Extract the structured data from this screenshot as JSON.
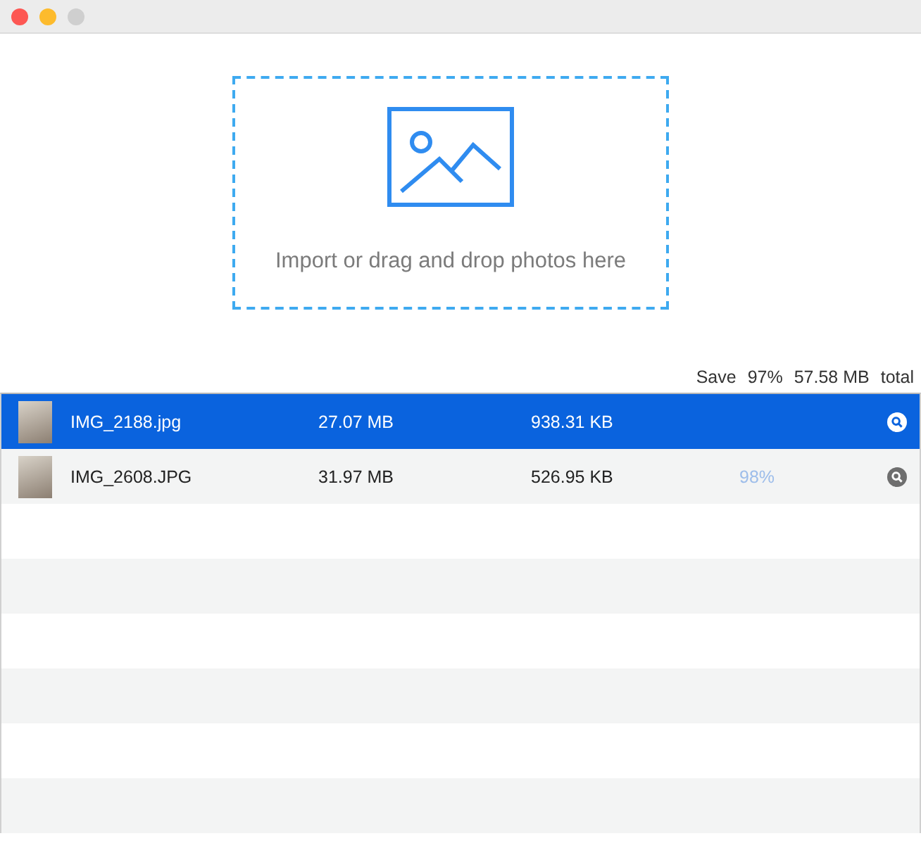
{
  "drop_zone": {
    "label": "Import or drag and drop photos here"
  },
  "summary": {
    "save_label": "Save",
    "percent": "97%",
    "amount": "57.58 MB",
    "total_label": "total"
  },
  "files": [
    {
      "name": "IMG_2188.jpg",
      "original_size": "27.07 MB",
      "compressed_size": "938.31 KB",
      "selected": true
    },
    {
      "name": "IMG_2608.JPG",
      "original_size": "31.97 MB",
      "compressed_size": "526.95 KB",
      "saving": "98%",
      "selected": false
    }
  ]
}
